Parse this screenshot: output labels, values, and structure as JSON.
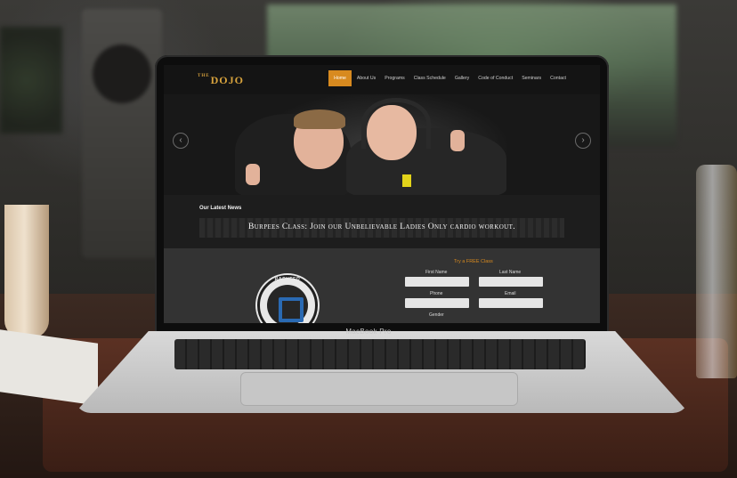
{
  "device_label": "MacBook Pro",
  "site": {
    "logo": {
      "prefix": "THE",
      "name": "DOJO"
    },
    "nav": [
      {
        "label": "Home",
        "active": true
      },
      {
        "label": "About Us",
        "active": false
      },
      {
        "label": "Programs",
        "active": false
      },
      {
        "label": "Class Schedule",
        "active": false
      },
      {
        "label": "Gallery",
        "active": false
      },
      {
        "label": "Code of Conduct",
        "active": false
      },
      {
        "label": "Seminars",
        "active": false
      },
      {
        "label": "Contact",
        "active": false
      }
    ],
    "hero": {
      "prev_arrow": "‹",
      "next_arrow": "›"
    },
    "news": {
      "heading": "Our Latest News",
      "banner_text": "Burpees Class: Join our Unbelievable Ladies Only cardio workout."
    },
    "badge": {
      "text": "RASHEED"
    },
    "form": {
      "title": "Try a FREE Class",
      "first_name_label": "First Name",
      "last_name_label": "Last Name",
      "phone_label": "Phone",
      "email_label": "Email",
      "gender_label": "Gender"
    }
  },
  "colors": {
    "accent": "#d88a1f",
    "logo": "#d8a33d",
    "badge_blue": "#2a6ab3"
  }
}
